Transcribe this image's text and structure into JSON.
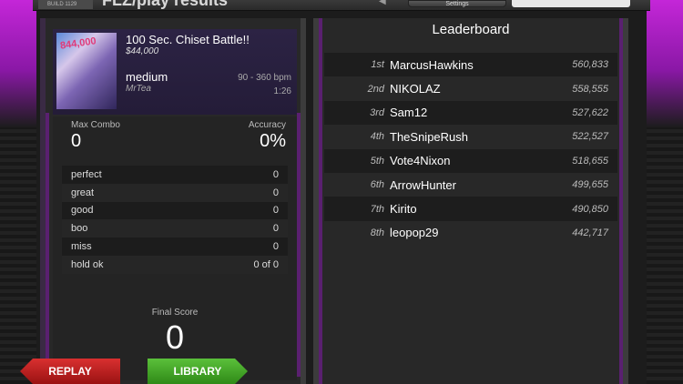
{
  "header": {
    "title": "FLZ/play results",
    "build": "BUILD 1129",
    "settings_label": "Settings"
  },
  "song": {
    "art_text": "844,000",
    "title": "100 Sec. Chiset Battle!!",
    "price": "$44,000",
    "difficulty": "medium",
    "artist": "MrTea",
    "bpm": "90 - 360 bpm",
    "length": "1:26"
  },
  "stats": {
    "max_combo_label": "Max Combo",
    "max_combo_value": "0",
    "accuracy_label": "Accuracy",
    "accuracy_value": "0%",
    "judgements": [
      {
        "label": "perfect",
        "value": "0"
      },
      {
        "label": "great",
        "value": "0"
      },
      {
        "label": "good",
        "value": "0"
      },
      {
        "label": "boo",
        "value": "0"
      },
      {
        "label": "miss",
        "value": "0"
      },
      {
        "label": "hold ok",
        "value": "0 of 0"
      }
    ],
    "final_score_label": "Final Score",
    "final_score_value": "0"
  },
  "buttons": {
    "replay": "REPLAY",
    "library": "LIBRARY"
  },
  "leaderboard": {
    "title": "Leaderboard",
    "entries": [
      {
        "rank": "1st",
        "name": "MarcusHawkins",
        "score": "560,833"
      },
      {
        "rank": "2nd",
        "name": "NIKOLAZ",
        "score": "558,555"
      },
      {
        "rank": "3rd",
        "name": "Sam12",
        "score": "527,622"
      },
      {
        "rank": "4th",
        "name": "TheSnipeRush",
        "score": "522,527"
      },
      {
        "rank": "5th",
        "name": "Vote4Nixon",
        "score": "518,655"
      },
      {
        "rank": "6th",
        "name": "ArrowHunter",
        "score": "499,655"
      },
      {
        "rank": "7th",
        "name": "Kirito",
        "score": "490,850"
      },
      {
        "rank": "8th",
        "name": "leopop29",
        "score": "442,717"
      }
    ]
  },
  "colors": {
    "accent_purple": "#c426d8",
    "replay_red": "#c62222",
    "library_green": "#4aa92c"
  }
}
